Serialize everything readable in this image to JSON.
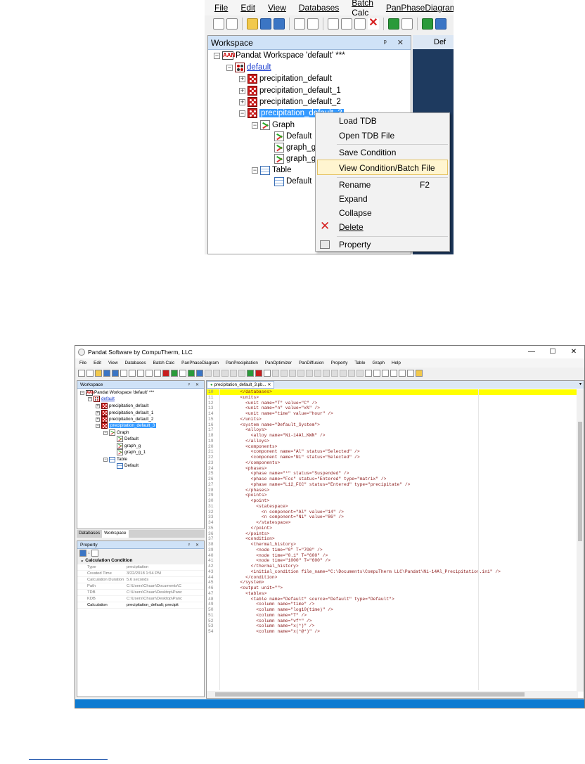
{
  "shot1": {
    "menu": [
      "File",
      "Edit",
      "View",
      "Databases",
      "Batch Calc",
      "PanPhaseDiagram"
    ],
    "workspace_title": "Workspace",
    "panel_controls": "ᵖ ✕",
    "doc_tab": "Def",
    "tree": {
      "root": "Pandat Workspace 'default' ***",
      "db": "default",
      "cond0": "precipitation_default",
      "cond1": "precipitation_default_1",
      "cond2": "precipitation_default_2",
      "cond3": "precipitation_default_3",
      "graph": "Graph",
      "graph_default": "Default",
      "graph_g": "graph_g",
      "graph_g1": "graph_g",
      "table": "Table",
      "table_default": "Default"
    },
    "context_menu": {
      "load_tdb": "Load TDB",
      "open_tdb": "Open TDB File",
      "save_condition": "Save Condition",
      "view_condition": "View Condition/Batch File",
      "rename": "Rename",
      "rename_shortcut": "F2",
      "expand": "Expand",
      "collapse": "Collapse",
      "delete": "Delete",
      "property": "Property"
    }
  },
  "shot2": {
    "window_title": "Pandat Software by CompuTherm, LLC",
    "window_controls": [
      "—",
      "☐",
      "✕"
    ],
    "menu": [
      "File",
      "Edit",
      "View",
      "Databases",
      "Batch Calc",
      "PanPhaseDiagram",
      "PanPrecipitation",
      "PanOptimizer",
      "PanDiffusion",
      "Property",
      "Table",
      "Graph",
      "Help"
    ],
    "workspace_title": "Workspace",
    "tree": {
      "root": "Pandat Workspace 'default' ***",
      "db": "default",
      "cond0": "precipitation_default",
      "cond1": "precipitation_default_1",
      "cond2": "precipitation_default_2",
      "cond3": "precipitation_default_3",
      "graph": "Graph",
      "graph_default": "Default",
      "graph_g": "graph_g",
      "graph_g1": "graph_g_1",
      "table": "Table",
      "table_default": "Default"
    },
    "bottom_tabs": [
      "Databases",
      "Workspace"
    ],
    "property_title": "Property",
    "property_category": "Calculation Condition",
    "properties": [
      {
        "key": "Type",
        "value": "precipitation"
      },
      {
        "key": "Created Time",
        "value": "3/22/2018 1:54 PM"
      },
      {
        "key": "Calculation Duration",
        "value": "5.6 seconds"
      },
      {
        "key": "Path",
        "value": "C:\\Users\\Chuan\\Documents\\C"
      },
      {
        "key": "TDB",
        "value": "C:\\Users\\Chuan\\Desktop\\Panc"
      },
      {
        "key": "KDB",
        "value": "C:\\Users\\Chuan\\Desktop\\Panc"
      },
      {
        "key": "Calculation",
        "value": "precipitation_default; precipit"
      }
    ],
    "doc_tab": "precipitation_default_3.pb...",
    "code_lines": [
      {
        "n": "10",
        "t": "  </databases>"
      },
      {
        "n": "11",
        "t": "  <units>"
      },
      {
        "n": "12",
        "t": "    <unit name=\"T\" value=\"C\" />"
      },
      {
        "n": "13",
        "t": "    <unit name=\"n\" value=\"x%\" />"
      },
      {
        "n": "14",
        "t": "    <unit name=\"time\" value=\"hour\" />"
      },
      {
        "n": "15",
        "t": "  </units>"
      },
      {
        "n": "16",
        "t": "  <system name=\"Default_System\">"
      },
      {
        "n": "17",
        "t": "    <alloys>"
      },
      {
        "n": "18",
        "t": "      <alloy name=\"Ni-14Al_KWN\" />"
      },
      {
        "n": "19",
        "t": "    </alloys>"
      },
      {
        "n": "20",
        "t": "    <components>"
      },
      {
        "n": "21",
        "t": "      <component name=\"Al\" status=\"Selected\" />"
      },
      {
        "n": "22",
        "t": "      <component name=\"Ni\" status=\"Selected\" />"
      },
      {
        "n": "23",
        "t": "    </components>"
      },
      {
        "n": "24",
        "t": "    <phases>"
      },
      {
        "n": "25",
        "t": "      <phase name=\"*\" status=\"Suspended\" />"
      },
      {
        "n": "26",
        "t": "      <phase name=\"Fcc\" status=\"Entered\" type=\"matrix\" />"
      },
      {
        "n": "27",
        "t": "      <phase name=\"L12_FCC\" status=\"Entered\" type=\"precipitate\" />"
      },
      {
        "n": "28",
        "t": "    </phases>"
      },
      {
        "n": "29",
        "t": "    <points>"
      },
      {
        "n": "30",
        "t": "      <point>"
      },
      {
        "n": "31",
        "t": "        <statespace>"
      },
      {
        "n": "32",
        "t": "          <n component=\"Al\" value=\"14\" />"
      },
      {
        "n": "33",
        "t": "          <n component=\"Ni\" value=\"86\" />"
      },
      {
        "n": "34",
        "t": "        </statespace>"
      },
      {
        "n": "35",
        "t": "      </point>"
      },
      {
        "n": "36",
        "t": "    </points>"
      },
      {
        "n": "37",
        "t": "    <condition>"
      },
      {
        "n": "38",
        "t": "      <thermal_history>"
      },
      {
        "n": "39",
        "t": "        <node time=\"0\" T=\"700\" />"
      },
      {
        "n": "40",
        "t": "        <node time=\"0.1\" T=\"600\" />"
      },
      {
        "n": "41",
        "t": "        <node time=\"1000\" T=\"600\" />"
      },
      {
        "n": "42",
        "t": "      </thermal_history>"
      },
      {
        "n": "43",
        "t": "      <initial_condition file_name=\"C:\\Documents\\CompuTherm LLC\\Pandat\\Ni-14Al_Precipitation.ini\" />"
      },
      {
        "n": "44",
        "t": "    </condition>"
      },
      {
        "n": "45",
        "t": "  </system>"
      },
      {
        "n": "46",
        "t": "  <output unit=\"\">"
      },
      {
        "n": "47",
        "t": "    <tables>"
      },
      {
        "n": "48",
        "t": "      <table name=\"Default\" source=\"Default\" type=\"Default\">"
      },
      {
        "n": "49",
        "t": "        <column name=\"time\" />"
      },
      {
        "n": "50",
        "t": "        <column name=\"log10(time)\" />"
      },
      {
        "n": "51",
        "t": "        <column name=\"T\" />"
      },
      {
        "n": "52",
        "t": "        <column name=\"vf*\" />"
      },
      {
        "n": "53",
        "t": "        <column name=\"x(*)\" />"
      },
      {
        "n": "54",
        "t": "        <column name=\"x(*@*)\" />"
      }
    ]
  },
  "colors": {
    "selection": "#3399ff",
    "menu_highlight": "#fff5d0",
    "status_bar": "#0e7bd1",
    "current_line": "#ffff00",
    "xml_text": "#8a1a1a"
  }
}
